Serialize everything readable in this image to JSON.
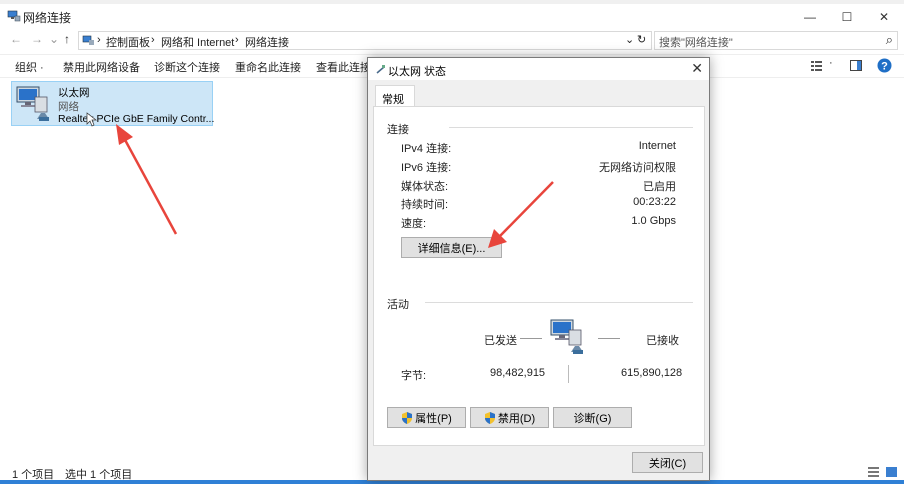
{
  "window": {
    "title": "网络连接",
    "minimize_glyph": "—",
    "maximize_glyph": "☐",
    "close_glyph": "✕"
  },
  "nav": {
    "back": "←",
    "forward": "→",
    "recent": "⌄",
    "up": "↑",
    "address": [
      "控制面板",
      "网络和 Internet",
      "网络连接"
    ],
    "separator": "›",
    "dropdown_glyph": "⌄",
    "refresh_glyph": "↻",
    "search_placeholder": "搜索\"网络连接\"",
    "search_glyph": "⌕"
  },
  "toolbar": {
    "organize": "组织 ·",
    "disable": "禁用此网络设备",
    "diagnose": "诊断这个连接",
    "rename": "重命名此连接",
    "view_status": "查看此连接",
    "view_dropdown": "·"
  },
  "adapter": {
    "name": "以太网",
    "network": "网络",
    "device": "Realtek PCIe GbE Family Contr..."
  },
  "statusbar": {
    "count": "1 个项目",
    "selected": "选中 1 个项目"
  },
  "dialog": {
    "title": "以太网 状态",
    "close_glyph": "✕",
    "tab": "常规",
    "connection_group": "连接",
    "rows": [
      {
        "label": "IPv4 连接:",
        "value": "Internet"
      },
      {
        "label": "IPv6 连接:",
        "value": "无网络访问权限"
      },
      {
        "label": "媒体状态:",
        "value": "已启用"
      },
      {
        "label": "持续时间:",
        "value": "00:23:22"
      },
      {
        "label": "速度:",
        "value": "1.0 Gbps"
      }
    ],
    "details_button": "详细信息(E)...",
    "activity_group": "活动",
    "sent_label": "已发送",
    "received_label": "已接收",
    "bytes_label": "字节:",
    "bytes_sent": "98,482,915",
    "bytes_received": "615,890,128",
    "properties_button": "属性(P)",
    "disable_button": "禁用(D)",
    "diagnose_button": "诊断(G)",
    "close_button": "关闭(C)"
  },
  "colors": {
    "selection_fill": "#cde6f7",
    "arrow": "#e8453c",
    "accent": "#2f80d6"
  }
}
